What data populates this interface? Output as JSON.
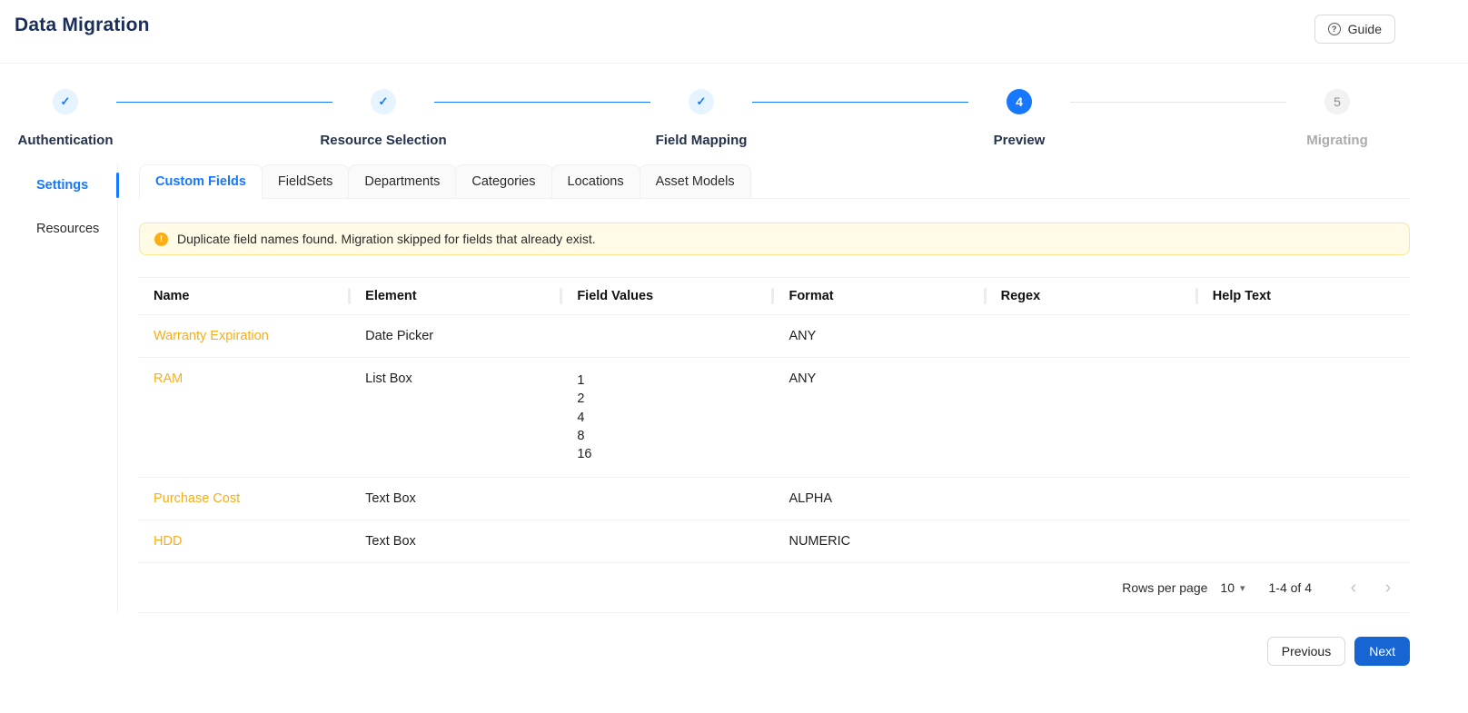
{
  "page": {
    "title": "Data Migration"
  },
  "header": {
    "guide_label": "Guide"
  },
  "icons": {
    "guide": "?",
    "warning": "!",
    "check": "✓",
    "caret_down": "▾",
    "chevron_left": "‹",
    "chevron_right": "›"
  },
  "stepper": {
    "steps": [
      {
        "label": "Authentication",
        "state": "completed"
      },
      {
        "label": "Resource Selection",
        "state": "completed"
      },
      {
        "label": "Field Mapping",
        "state": "completed"
      },
      {
        "label": "Preview",
        "state": "active",
        "number": "4"
      },
      {
        "label": "Migrating",
        "state": "pending",
        "number": "5"
      }
    ]
  },
  "sidebar": {
    "items": [
      {
        "label": "Settings",
        "active": true
      },
      {
        "label": "Resources",
        "active": false
      }
    ]
  },
  "tabs": [
    "Custom Fields",
    "FieldSets",
    "Departments",
    "Categories",
    "Locations",
    "Asset Models"
  ],
  "alert": {
    "message": "Duplicate field names found. Migration skipped for fields that already exist."
  },
  "table": {
    "columns": [
      "Name",
      "Element",
      "Field Values",
      "Format",
      "Regex",
      "Help Text"
    ],
    "rows": [
      {
        "name": "Warranty Expiration",
        "element": "Date Picker",
        "field_values": [],
        "format": "ANY",
        "regex": "",
        "help_text": ""
      },
      {
        "name": "RAM",
        "element": "List Box",
        "field_values": [
          "1",
          "2",
          "4",
          "8",
          "16"
        ],
        "format": "ANY",
        "regex": "",
        "help_text": ""
      },
      {
        "name": "Purchase Cost",
        "element": "Text Box",
        "field_values": [],
        "format": "ALPHA",
        "regex": "",
        "help_text": ""
      },
      {
        "name": "HDD",
        "element": "Text Box",
        "field_values": [],
        "format": "NUMERIC",
        "regex": "",
        "help_text": ""
      }
    ],
    "pagination": {
      "rows_per_page_label": "Rows per page",
      "rows_per_page_value": "10",
      "range": "1-4 of 4"
    }
  },
  "actions": {
    "previous": "Previous",
    "next": "Next"
  },
  "colors": {
    "primary": "#1677ff",
    "title": "#1a2e5c",
    "row_link": "#faad14",
    "warning_bg": "#fffbe6",
    "warning_border": "#ffe58f",
    "warning_icon": "#faad14",
    "next_button": "#1765d3"
  }
}
